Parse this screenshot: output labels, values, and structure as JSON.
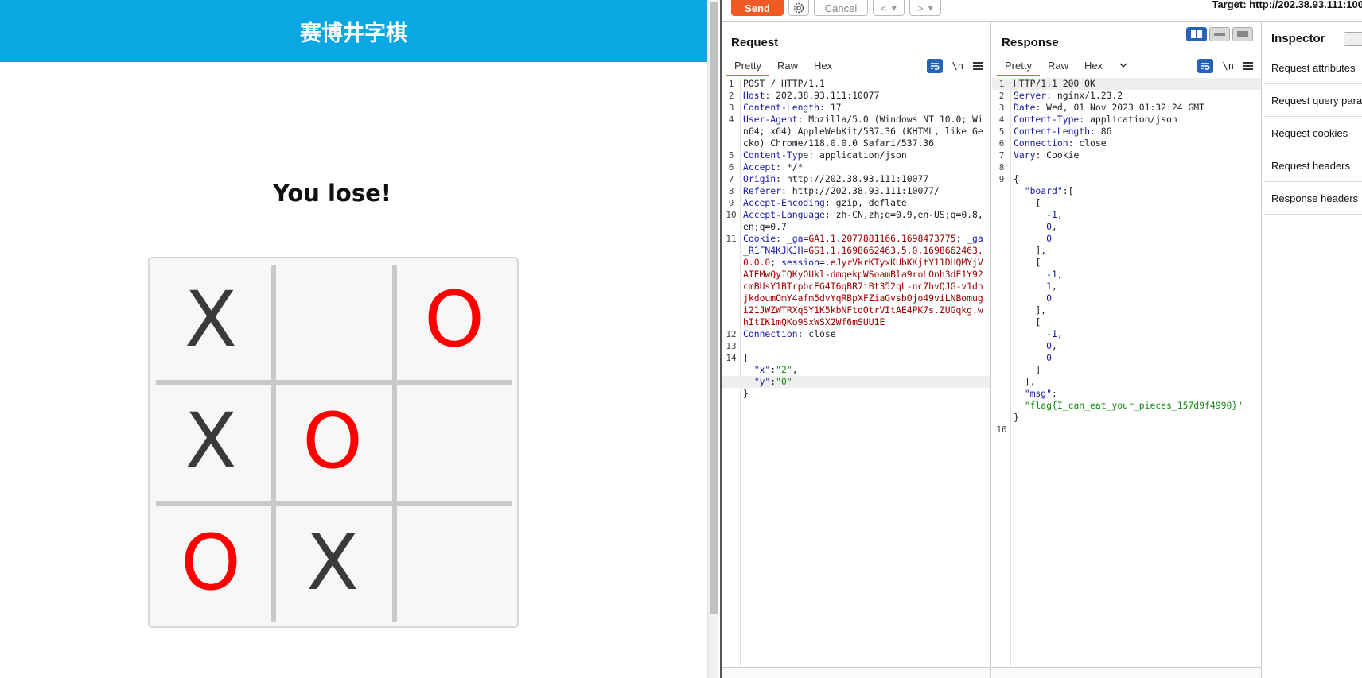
{
  "game": {
    "title": "赛博井字棋",
    "status": "You lose!",
    "board": [
      [
        "X",
        "",
        "O"
      ],
      [
        "X",
        "O",
        ""
      ],
      [
        "O",
        "X",
        ""
      ]
    ]
  },
  "burp": {
    "toolbar": {
      "send": "Send",
      "cancel": "Cancel",
      "prev": "<",
      "next": ">",
      "dropdown": "▾",
      "target": "Target: http://202.38.93.111:100"
    },
    "request": {
      "title": "Request",
      "tabs": [
        "Pretty",
        "Raw",
        "Hex"
      ],
      "newline_label": "\\n",
      "lines": [
        {
          "n": "1",
          "parts": [
            [
              "t",
              "POST / HTTP/1.1"
            ]
          ]
        },
        {
          "n": "2",
          "parts": [
            [
              "h",
              "Host"
            ],
            [
              "t",
              ": 202.38.93.111:10077"
            ]
          ]
        },
        {
          "n": "3",
          "parts": [
            [
              "h",
              "Content-Length"
            ],
            [
              "t",
              ": 17"
            ]
          ]
        },
        {
          "n": "4",
          "parts": [
            [
              "h",
              "User-Agent"
            ],
            [
              "t",
              ": Mozilla/5.0 (Windows NT 10.0; Win64; x64) AppleWebKit/537.36 (KHTML, like Gecko) Chrome/118.0.0.0 Safari/537.36"
            ]
          ]
        },
        {
          "n": "5",
          "parts": [
            [
              "h",
              "Content-Type"
            ],
            [
              "t",
              ": application/json"
            ]
          ]
        },
        {
          "n": "6",
          "parts": [
            [
              "h",
              "Accept"
            ],
            [
              "t",
              ": */*"
            ]
          ]
        },
        {
          "n": "7",
          "parts": [
            [
              "h",
              "Origin"
            ],
            [
              "t",
              ": http://202.38.93.111:10077"
            ]
          ]
        },
        {
          "n": "8",
          "parts": [
            [
              "h",
              "Referer"
            ],
            [
              "t",
              ": http://202.38.93.111:10077/"
            ]
          ]
        },
        {
          "n": "9",
          "parts": [
            [
              "h",
              "Accept-Encoding"
            ],
            [
              "t",
              ": gzip, deflate"
            ]
          ]
        },
        {
          "n": "10",
          "parts": [
            [
              "h",
              "Accept-Language"
            ],
            [
              "t",
              ": zh-CN,zh;q=0.9,en-US;q=0.8,en;q=0.7"
            ]
          ]
        },
        {
          "n": "11",
          "parts": [
            [
              "h",
              "Cookie"
            ],
            [
              "t",
              ": "
            ],
            [
              "h",
              "_ga"
            ],
            [
              "t",
              "="
            ],
            [
              "c",
              "GA1.1.2077881166.1698473775"
            ],
            [
              "t",
              "; "
            ],
            [
              "h",
              "_ga_R1FN4KJKJH"
            ],
            [
              "t",
              "="
            ],
            [
              "c",
              "GS1.1.1698662463.5.0.1698662463.0.0.0"
            ],
            [
              "t",
              "; "
            ],
            [
              "h",
              "session"
            ],
            [
              "t",
              "="
            ],
            [
              "c",
              ".eJyrVkrKTyxKUbKKjtY11DHQMYjVATEMwQyIQKyOUkl-dmqekpWSoamBla9roLOnh3dE1Y92cmBUsY1BTrpbcEG4T6qBR7iBt352qL-nc7hvQJG-v1dhjkdoumOmY4afm5dvYqRBpXFZiaGvsbOjo49viLNBomugi21JWZWTRXqSY1K5kbNFtqOtrVItAE4PK7s.ZUGqkg.whItIK1mQKo9SxWSX2Wf6mSUU1E"
            ]
          ]
        },
        {
          "n": "12",
          "parts": [
            [
              "h",
              "Connection"
            ],
            [
              "t",
              ": close"
            ]
          ]
        },
        {
          "n": "13",
          "parts": [
            [
              "t",
              ""
            ]
          ]
        },
        {
          "n": "14",
          "parts": [
            [
              "t",
              "{"
            ]
          ]
        },
        {
          "n": "",
          "parts": [
            [
              "t",
              "  "
            ],
            [
              "k",
              "\"x\""
            ],
            [
              "t",
              ":"
            ],
            [
              "s",
              "\"2\""
            ],
            [
              "t",
              ","
            ]
          ]
        },
        {
          "n": "",
          "hl": true,
          "parts": [
            [
              "t",
              "  "
            ],
            [
              "k",
              "\"y\""
            ],
            [
              "t",
              ":"
            ],
            [
              "s",
              "\"0\""
            ]
          ]
        },
        {
          "n": "",
          "parts": [
            [
              "t",
              "}"
            ]
          ]
        }
      ]
    },
    "response": {
      "title": "Response",
      "tabs": [
        "Pretty",
        "Raw",
        "Hex"
      ],
      "newline_label": "\\n",
      "lines": [
        {
          "n": "1",
          "hl": true,
          "parts": [
            [
              "t",
              "HTTP/1.1 200 OK"
            ]
          ]
        },
        {
          "n": "2",
          "parts": [
            [
              "h",
              "Server"
            ],
            [
              "t",
              ": nginx/1.23.2"
            ]
          ]
        },
        {
          "n": "3",
          "parts": [
            [
              "h",
              "Date"
            ],
            [
              "t",
              ": Wed, 01 Nov 2023 01:32:24 GMT"
            ]
          ]
        },
        {
          "n": "4",
          "parts": [
            [
              "h",
              "Content-Type"
            ],
            [
              "t",
              ": application/json"
            ]
          ]
        },
        {
          "n": "5",
          "parts": [
            [
              "h",
              "Content-Length"
            ],
            [
              "t",
              ": 86"
            ]
          ]
        },
        {
          "n": "6",
          "parts": [
            [
              "h",
              "Connection"
            ],
            [
              "t",
              ": close"
            ]
          ]
        },
        {
          "n": "7",
          "parts": [
            [
              "h",
              "Vary"
            ],
            [
              "t",
              ": Cookie"
            ]
          ]
        },
        {
          "n": "8",
          "parts": [
            [
              "t",
              ""
            ]
          ]
        },
        {
          "n": "9",
          "parts": [
            [
              "t",
              "{"
            ]
          ]
        },
        {
          "n": "",
          "parts": [
            [
              "t",
              "  "
            ],
            [
              "k",
              "\"board\""
            ],
            [
              "t",
              ":["
            ]
          ]
        },
        {
          "n": "",
          "parts": [
            [
              "t",
              "    ["
            ]
          ]
        },
        {
          "n": "",
          "parts": [
            [
              "t",
              "      "
            ],
            [
              "d",
              "-1"
            ],
            [
              "t",
              ","
            ]
          ]
        },
        {
          "n": "",
          "parts": [
            [
              "t",
              "      "
            ],
            [
              "d",
              "0"
            ],
            [
              "t",
              ","
            ]
          ]
        },
        {
          "n": "",
          "parts": [
            [
              "t",
              "      "
            ],
            [
              "d",
              "0"
            ]
          ]
        },
        {
          "n": "",
          "parts": [
            [
              "t",
              "    ],"
            ]
          ]
        },
        {
          "n": "",
          "parts": [
            [
              "t",
              "    ["
            ]
          ]
        },
        {
          "n": "",
          "parts": [
            [
              "t",
              "      "
            ],
            [
              "d",
              "-1"
            ],
            [
              "t",
              ","
            ]
          ]
        },
        {
          "n": "",
          "parts": [
            [
              "t",
              "      "
            ],
            [
              "d",
              "1"
            ],
            [
              "t",
              ","
            ]
          ]
        },
        {
          "n": "",
          "parts": [
            [
              "t",
              "      "
            ],
            [
              "d",
              "0"
            ]
          ]
        },
        {
          "n": "",
          "parts": [
            [
              "t",
              "    ],"
            ]
          ]
        },
        {
          "n": "",
          "parts": [
            [
              "t",
              "    ["
            ]
          ]
        },
        {
          "n": "",
          "parts": [
            [
              "t",
              "      "
            ],
            [
              "d",
              "-1"
            ],
            [
              "t",
              ","
            ]
          ]
        },
        {
          "n": "",
          "parts": [
            [
              "t",
              "      "
            ],
            [
              "d",
              "0"
            ],
            [
              "t",
              ","
            ]
          ]
        },
        {
          "n": "",
          "parts": [
            [
              "t",
              "      "
            ],
            [
              "d",
              "0"
            ]
          ]
        },
        {
          "n": "",
          "parts": [
            [
              "t",
              "    ]"
            ]
          ]
        },
        {
          "n": "",
          "parts": [
            [
              "t",
              "  ],"
            ]
          ]
        },
        {
          "n": "",
          "parts": [
            [
              "t",
              "  "
            ],
            [
              "k",
              "\"msg\""
            ],
            [
              "t",
              ":"
            ]
          ]
        },
        {
          "n": "",
          "parts": [
            [
              "t",
              "  "
            ],
            [
              "s",
              "\"flag{I_can_eat_your_pieces_157d9f4990}\""
            ]
          ]
        },
        {
          "n": "",
          "parts": [
            [
              "t",
              "}"
            ]
          ]
        },
        {
          "n": "10",
          "parts": [
            [
              "t",
              ""
            ]
          ]
        }
      ]
    },
    "inspector": {
      "title": "Inspector",
      "items": [
        "Request attributes",
        "Request query parameters",
        "Request cookies",
        "Request headers",
        "Response headers"
      ]
    }
  }
}
